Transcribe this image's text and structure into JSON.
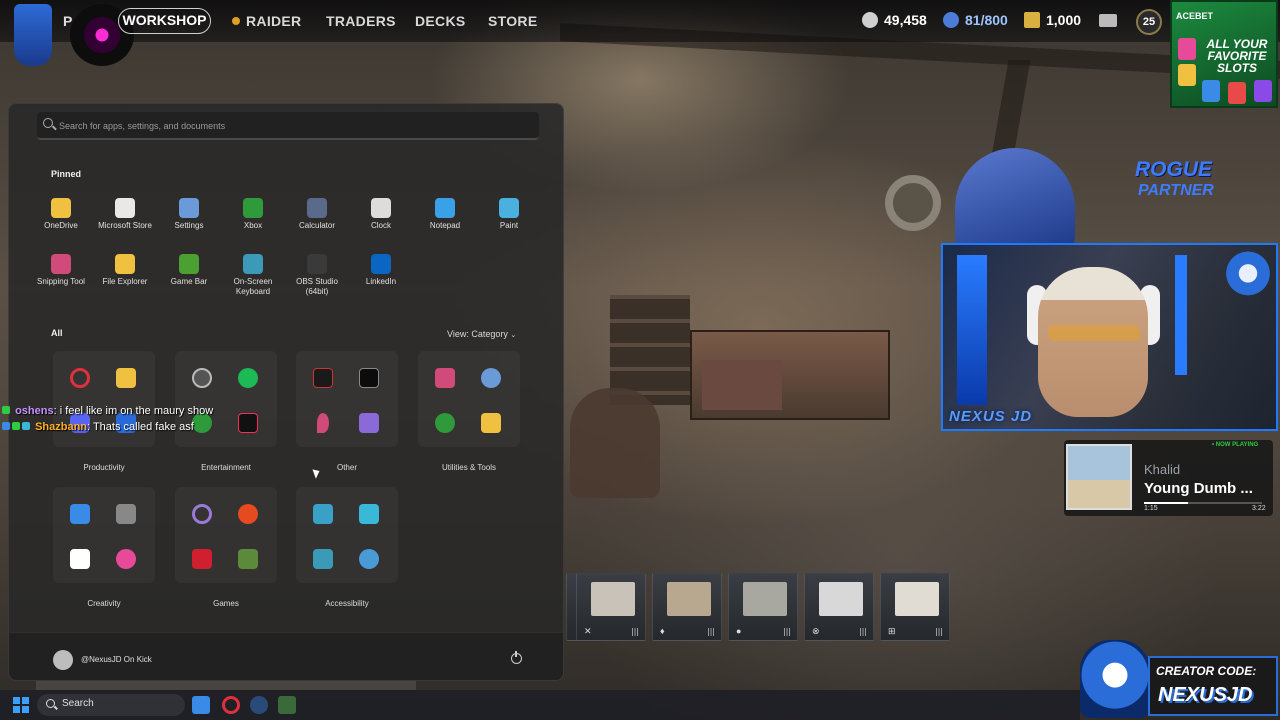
{
  "topnav": {
    "first_label": "P",
    "workshop": "WORKSHOP",
    "raider": "RAIDER",
    "traders": "TRADERS",
    "decks": "DECKS",
    "store": "STORE",
    "currency_coins": "49,458",
    "currency_capacity": "81/800",
    "currency_credits": "1,000",
    "level": "25"
  },
  "ad": {
    "brand": "ACEBET",
    "text": "ALL YOUR FAVORITE SLOTS"
  },
  "start_menu": {
    "search_placeholder": "Search for apps, settings, and documents",
    "pinned_title": "Pinned",
    "pinned": [
      {
        "label": "OneDrive",
        "icon": "onedrive-icon",
        "color": "#f0c040"
      },
      {
        "label": "Microsoft Store",
        "icon": "store-icon",
        "color": "#e8e8e8"
      },
      {
        "label": "Settings",
        "icon": "gear-icon",
        "color": "#6a9ad8"
      },
      {
        "label": "Xbox",
        "icon": "xbox-icon",
        "color": "#2e9a3a"
      },
      {
        "label": "Calculator",
        "icon": "calculator-icon",
        "color": "#5a6a8a"
      },
      {
        "label": "Clock",
        "icon": "clock-icon",
        "color": "#dcdcdc"
      },
      {
        "label": "Notepad",
        "icon": "notepad-icon",
        "color": "#3aa0e8"
      },
      {
        "label": "Paint",
        "icon": "paint-icon",
        "color": "#4ab0e0"
      },
      {
        "label": "Snipping Tool",
        "icon": "snipping-tool-icon",
        "color": "#d04a7a"
      },
      {
        "label": "File Explorer",
        "icon": "folder-icon",
        "color": "#f0c040"
      },
      {
        "label": "Game Bar",
        "icon": "game-bar-icon",
        "color": "#4aa030"
      },
      {
        "label": "On-Screen Keyboard",
        "icon": "keyboard-icon",
        "color": "#3a9ab8"
      },
      {
        "label": "OBS Studio (64bit)",
        "icon": "obs-icon",
        "color": "#3a3a3a"
      },
      {
        "label": "LinkedIn",
        "icon": "linkedin-icon",
        "color": "#0a66c2"
      }
    ],
    "all_title": "All",
    "view_label": "View: Category",
    "categories": [
      {
        "label": "Productivity"
      },
      {
        "label": "Entertainment"
      },
      {
        "label": "Other"
      },
      {
        "label": "Utilities & Tools"
      },
      {
        "label": "Creativity"
      },
      {
        "label": "Games"
      },
      {
        "label": "Accessibility"
      }
    ],
    "user": "@NexusJD On Kick"
  },
  "chat": [
    {
      "user": "oshens",
      "message": "i feel like im on the maury show",
      "color": "#c890ff"
    },
    {
      "user": "Shazbann",
      "message": "Thats called fake asf",
      "color": "#ffb020"
    }
  ],
  "stream": {
    "cam_name": "NEXUS JD",
    "rogue_line1": "ROGUE",
    "rogue_line2": "PARTNER",
    "creator_line1": "CREATOR CODE:",
    "creator_line2": "NEXUSJD"
  },
  "now_playing": {
    "tag": "• NOW PLAYING",
    "artist": "Khalid",
    "title": "Young Dumb ...",
    "elapsed": "1:15",
    "duration": "3:22",
    "progress": 0.37
  },
  "taskbar": {
    "search_label": "Search"
  }
}
